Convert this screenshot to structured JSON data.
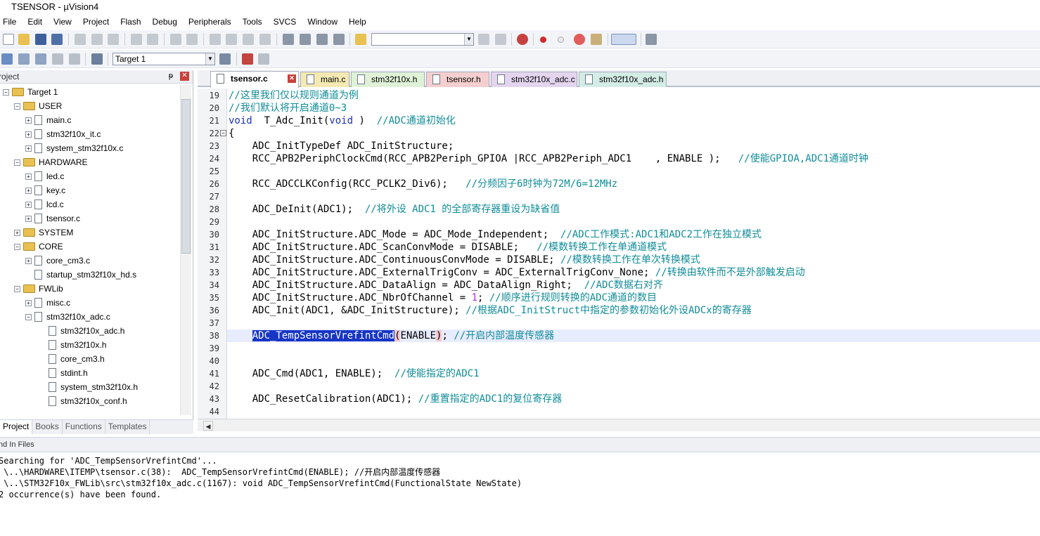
{
  "window": {
    "title": "TSENSOR  - µVision4"
  },
  "menu": [
    "File",
    "Edit",
    "View",
    "Project",
    "Flash",
    "Debug",
    "Peripherals",
    "Tools",
    "SVCS",
    "Window",
    "Help"
  ],
  "toolbar": {
    "target_select": "Target 1",
    "find_combo": ""
  },
  "project_panel": {
    "title": "roject",
    "tree": [
      {
        "label": "Target 1",
        "kind": "target",
        "depth": 0,
        "exp": "−"
      },
      {
        "label": "USER",
        "kind": "folder",
        "depth": 1,
        "exp": "−"
      },
      {
        "label": "main.c",
        "kind": "cfile",
        "depth": 2,
        "exp": "+"
      },
      {
        "label": "stm32f10x_it.c",
        "kind": "cfile",
        "depth": 2,
        "exp": "+"
      },
      {
        "label": "system_stm32f10x.c",
        "kind": "cfile",
        "depth": 2,
        "exp": "+"
      },
      {
        "label": "HARDWARE",
        "kind": "folder",
        "depth": 1,
        "exp": "−"
      },
      {
        "label": "led.c",
        "kind": "cfile",
        "depth": 2,
        "exp": "+"
      },
      {
        "label": "key.c",
        "kind": "cfile",
        "depth": 2,
        "exp": "+"
      },
      {
        "label": "lcd.c",
        "kind": "cfile",
        "depth": 2,
        "exp": "+"
      },
      {
        "label": "tsensor.c",
        "kind": "cfile",
        "depth": 2,
        "exp": "+"
      },
      {
        "label": "SYSTEM",
        "kind": "folder",
        "depth": 1,
        "exp": "+"
      },
      {
        "label": "CORE",
        "kind": "folder",
        "depth": 1,
        "exp": "−"
      },
      {
        "label": "core_cm3.c",
        "kind": "cfile",
        "depth": 2,
        "exp": "+"
      },
      {
        "label": "startup_stm32f10x_hd.s",
        "kind": "file",
        "depth": 2,
        "exp": ""
      },
      {
        "label": "FWLib",
        "kind": "folder",
        "depth": 1,
        "exp": "−"
      },
      {
        "label": "misc.c",
        "kind": "cfile",
        "depth": 2,
        "exp": "+"
      },
      {
        "label": "stm32f10x_adc.c",
        "kind": "cfile",
        "depth": 2,
        "exp": "−"
      },
      {
        "label": "stm32f10x_adc.h",
        "kind": "file",
        "depth": 3,
        "exp": ""
      },
      {
        "label": "stm32f10x.h",
        "kind": "file",
        "depth": 3,
        "exp": ""
      },
      {
        "label": "core_cm3.h",
        "kind": "file",
        "depth": 3,
        "exp": ""
      },
      {
        "label": "stdint.h",
        "kind": "file",
        "depth": 3,
        "exp": ""
      },
      {
        "label": "system_stm32f10x.h",
        "kind": "file",
        "depth": 3,
        "exp": ""
      },
      {
        "label": "stm32f10x_conf.h",
        "kind": "file",
        "depth": 3,
        "exp": ""
      }
    ],
    "tabs": [
      "Project",
      "Books",
      "Functions",
      "Templates"
    ]
  },
  "editor": {
    "tabs": [
      {
        "label": "tsensor.c",
        "color": "#f4f6f9",
        "active": true
      },
      {
        "label": "main.c",
        "color": "#f4e9b3",
        "active": false
      },
      {
        "label": "stm32f10x.h",
        "color": "#dff2d7",
        "active": false
      },
      {
        "label": "tsensor.h",
        "color": "#f5cfcf",
        "active": false
      },
      {
        "label": "stm32f10x_adc.c",
        "color": "#e4d5ef",
        "active": false
      },
      {
        "label": "stm32f10x_adc.h",
        "color": "#d4ece6",
        "active": false
      }
    ],
    "lines": [
      {
        "n": "19",
        "segs": [
          [
            "cm",
            "//这里我们仅以规则通道为例"
          ]
        ]
      },
      {
        "n": "20",
        "segs": [
          [
            "cm",
            "//我们默认将开启通道0~3"
          ]
        ]
      },
      {
        "n": "21",
        "segs": [
          [
            "kw",
            "void"
          ],
          [
            "",
            "  T_Adc_Init("
          ],
          [
            "kw",
            "void"
          ],
          [
            "",
            " )  "
          ],
          [
            "cm",
            "//ADC通道初始化"
          ]
        ]
      },
      {
        "n": "22",
        "segs": [
          [
            "",
            "{"
          ]
        ],
        "fold": "−"
      },
      {
        "n": "23",
        "segs": [
          [
            "",
            "    ADC_InitTypeDef ADC_InitStructure;"
          ]
        ]
      },
      {
        "n": "24",
        "segs": [
          [
            "",
            "    RCC_APB2PeriphClockCmd(RCC_APB2Periph_GPIOA |RCC_APB2Periph_ADC1    , ENABLE );   "
          ],
          [
            "cm",
            "//使能GPIOA,ADC1通道时钟"
          ]
        ]
      },
      {
        "n": "25",
        "segs": [
          [
            "",
            ""
          ]
        ]
      },
      {
        "n": "26",
        "segs": [
          [
            "",
            "    RCC_ADCCLKConfig(RCC_PCLK2_Div6);   "
          ],
          [
            "cm",
            "//分频因子6时钟为72M/6=12MHz"
          ]
        ]
      },
      {
        "n": "27",
        "segs": [
          [
            "",
            ""
          ]
        ]
      },
      {
        "n": "28",
        "segs": [
          [
            "",
            "    ADC_DeInit(ADC1);  "
          ],
          [
            "cm",
            "//将外设 ADC1 的全部寄存器重设为缺省值"
          ]
        ]
      },
      {
        "n": "29",
        "segs": [
          [
            "",
            ""
          ]
        ]
      },
      {
        "n": "30",
        "segs": [
          [
            "",
            "    ADC_InitStructure.ADC_Mode = ADC_Mode_Independent;  "
          ],
          [
            "cm",
            "//ADC工作模式:ADC1和ADC2工作在独立模式"
          ]
        ]
      },
      {
        "n": "31",
        "segs": [
          [
            "",
            "    ADC_InitStructure.ADC_ScanConvMode = DISABLE;   "
          ],
          [
            "cm",
            "//模数转换工作在单通道模式"
          ]
        ]
      },
      {
        "n": "32",
        "segs": [
          [
            "",
            "    ADC_InitStructure.ADC_ContinuousConvMode = DISABLE; "
          ],
          [
            "cm",
            "//模数转换工作在单次转换模式"
          ]
        ]
      },
      {
        "n": "33",
        "segs": [
          [
            "",
            "    ADC_InitStructure.ADC_ExternalTrigConv = ADC_ExternalTrigConv_None; "
          ],
          [
            "cm",
            "//转换由软件而不是外部触发启动"
          ]
        ]
      },
      {
        "n": "34",
        "segs": [
          [
            "",
            "    ADC_InitStructure.ADC_DataAlign = ADC_DataAlign_Right;  "
          ],
          [
            "cm",
            "//ADC数据右对齐"
          ]
        ]
      },
      {
        "n": "35",
        "segs": [
          [
            "",
            "    ADC_InitStructure.ADC_NbrOfChannel = "
          ],
          [
            "num",
            "1"
          ],
          [
            "",
            "; "
          ],
          [
            "cm",
            "//顺序进行规则转换的ADC通道的数目"
          ]
        ]
      },
      {
        "n": "36",
        "segs": [
          [
            "",
            "    ADC_Init(ADC1, &ADC_InitStructure); "
          ],
          [
            "cm",
            "//根据ADC_InitStruct中指定的参数初始化外设ADCx的寄存器"
          ]
        ]
      },
      {
        "n": "37",
        "segs": [
          [
            "",
            ""
          ]
        ]
      },
      {
        "n": "38",
        "segs": [
          [
            "",
            "    "
          ],
          [
            "sel",
            "ADC_TempSensorVrefintCmd"
          ],
          [
            "br",
            "("
          ],
          [
            "",
            "ENABLE"
          ],
          [
            "br",
            ")"
          ],
          [
            "",
            "; "
          ],
          [
            "cm",
            "//开启内部温度传感器"
          ]
        ],
        "current": true
      },
      {
        "n": "39",
        "segs": [
          [
            "",
            ""
          ]
        ]
      },
      {
        "n": "40",
        "segs": [
          [
            "",
            ""
          ]
        ]
      },
      {
        "n": "41",
        "segs": [
          [
            "",
            "    ADC_Cmd(ADC1, ENABLE);  "
          ],
          [
            "cm",
            "//使能指定的ADC1"
          ]
        ]
      },
      {
        "n": "42",
        "segs": [
          [
            "",
            ""
          ]
        ]
      },
      {
        "n": "43",
        "segs": [
          [
            "",
            "    ADC_ResetCalibration(ADC1); "
          ],
          [
            "cm",
            "//重置指定的ADC1的复位寄存器"
          ]
        ]
      },
      {
        "n": "44",
        "segs": [
          [
            "",
            ""
          ]
        ]
      }
    ]
  },
  "find_panel": {
    "title": "nd In Files",
    "lines": [
      "Searching for 'ADC_TempSensorVrefintCmd'...",
      " \\..\\HARDWARE\\ITEMP\\tsensor.c(38):  ADC_TempSensorVrefintCmd(ENABLE); //开启内部温度传感器",
      " \\..\\STM32F10x_FWLib\\src\\stm32f10x_adc.c(1167): void ADC_TempSensorVrefintCmd(FunctionalState NewState)",
      "2 occurrence(s) have been found."
    ]
  },
  "colors": {
    "comment": "#118c98",
    "keyword": "#1d2fbf",
    "selection": "#1736c6",
    "current_line": "#e8ecff"
  }
}
